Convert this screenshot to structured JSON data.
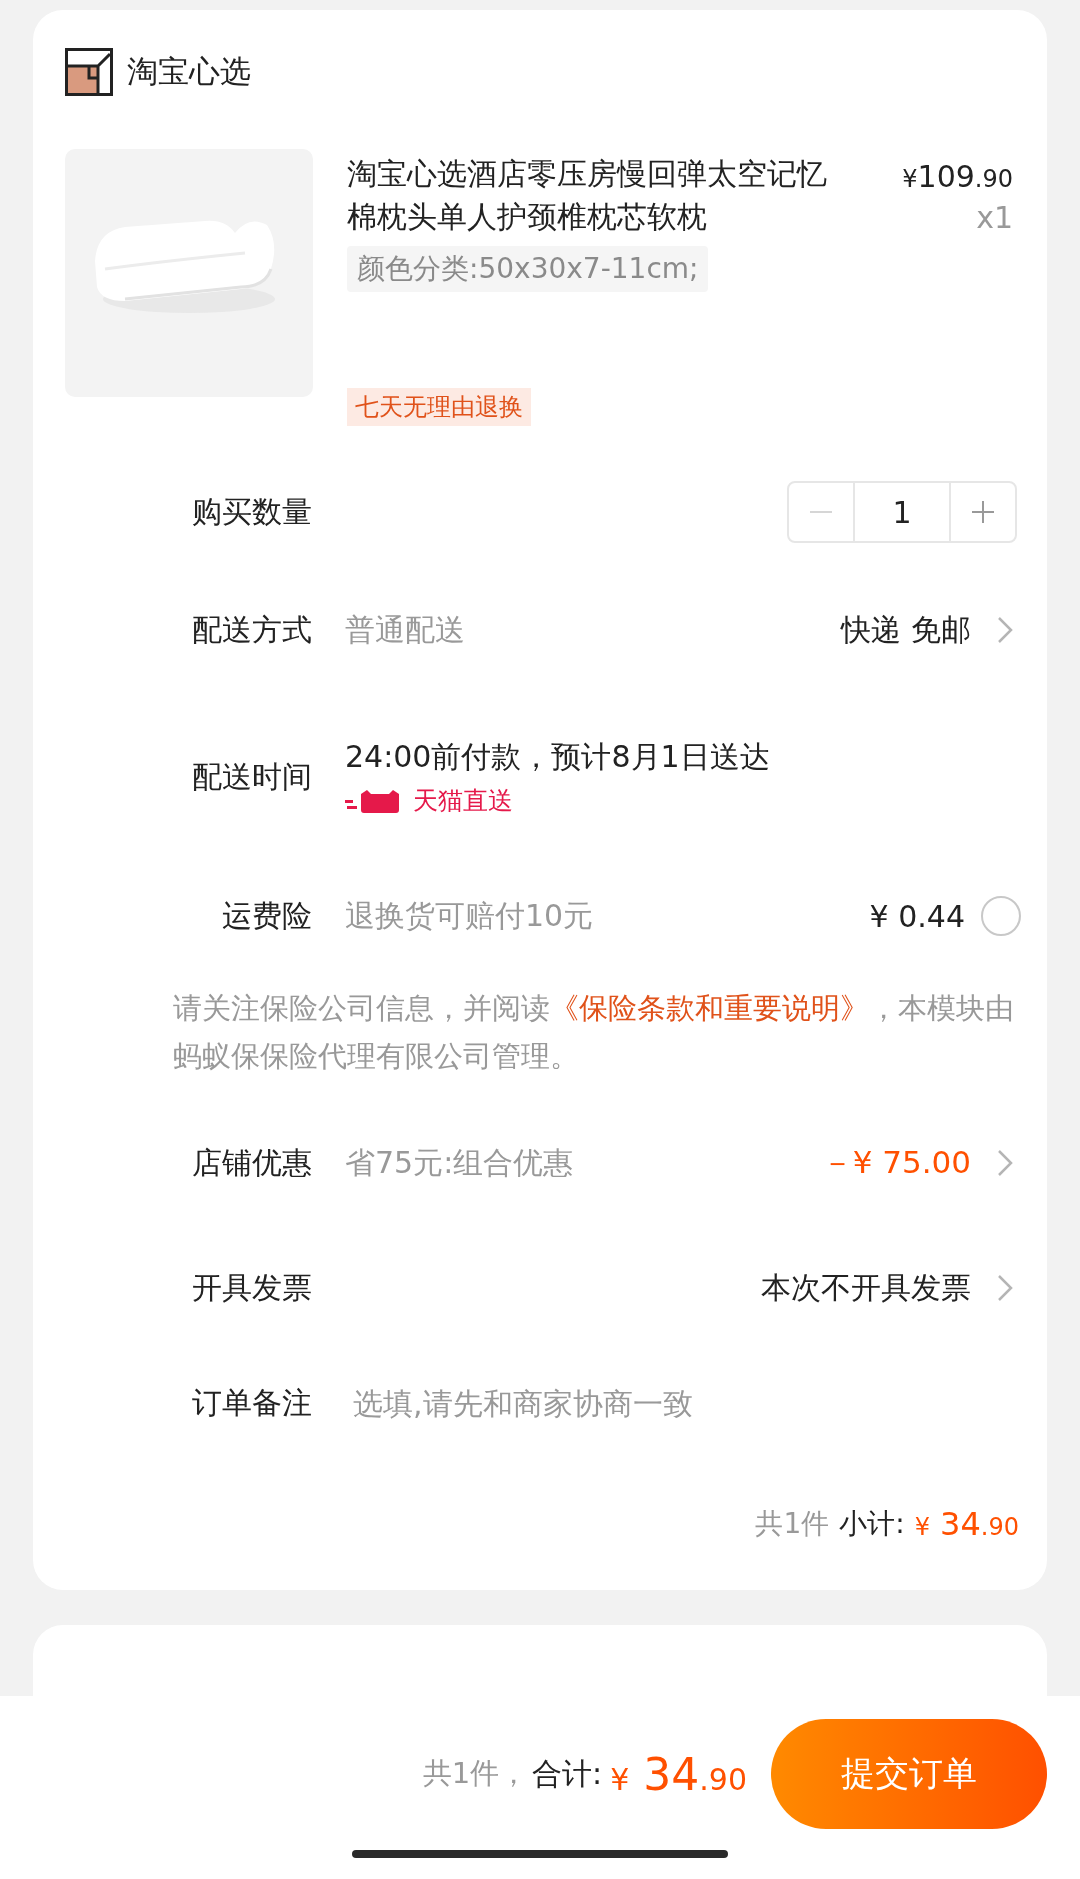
{
  "shop": {
    "name": "淘宝心选"
  },
  "product": {
    "title": "淘宝心选酒店零压房慢回弹太空记忆棉枕头单人护颈椎枕芯软枕",
    "price_symbol": "¥",
    "price_int": "109",
    "price_dec": ".90",
    "quantity": "x1",
    "sku": "颜色分类:50x30x7-11cm;",
    "tag": "七天无理由退换"
  },
  "quantity": {
    "label": "购买数量",
    "value": "1",
    "minus_disabled": true
  },
  "delivery": {
    "label": "配送方式",
    "value": "普通配送",
    "right": "快递 免邮"
  },
  "schedule": {
    "label": "配送时间",
    "value": "24:00前付款，预计8月1日送达",
    "badge": "天猫直送"
  },
  "insurance": {
    "label": "运费险",
    "value": "退换货可赔付10元",
    "price": "¥ 0.44",
    "selected": false
  },
  "notice": {
    "before": "请关注保险公司信息，并阅读",
    "link": "《保险条款和重要说明》",
    "after": "，本模块由蚂蚁保保险代理有限公司管理。"
  },
  "discount": {
    "label": "店铺优惠",
    "value": "省75元:组合优惠",
    "amount": "－¥ 75.00"
  },
  "invoice": {
    "label": "开具发票",
    "right": "本次不开具发票"
  },
  "remark": {
    "label": "订单备注",
    "placeholder": "选填,请先和商家协商一致"
  },
  "subtotal": {
    "count": "共1件",
    "label": "小计:",
    "symbol": "¥",
    "int": "34",
    "dec": ".90"
  },
  "footer": {
    "count": "共1件，",
    "label": "合计:",
    "symbol": "¥",
    "int": "34",
    "dec": ".90",
    "button": "提交订单"
  }
}
